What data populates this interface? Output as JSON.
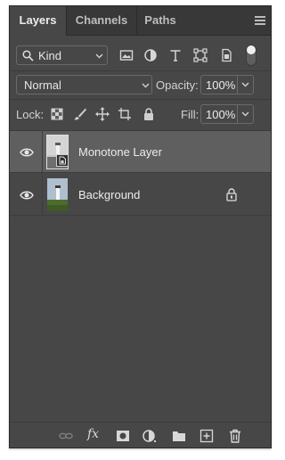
{
  "tabs": [
    {
      "label": "Layers",
      "active": true
    },
    {
      "label": "Channels",
      "active": false
    },
    {
      "label": "Paths",
      "active": false
    }
  ],
  "filter": {
    "kind_label": "Kind",
    "icons": [
      "image-filter-icon",
      "adjustment-filter-icon",
      "type-filter-icon",
      "shape-filter-icon",
      "smart-object-filter-icon"
    ],
    "toggle_on": true
  },
  "blend": {
    "mode": "Normal",
    "opacity_label": "Opacity:",
    "opacity_value": "100%"
  },
  "lock": {
    "label": "Lock:",
    "fill_label": "Fill:",
    "fill_value": "100%"
  },
  "layers": [
    {
      "name": "Monotone Layer",
      "visible": true,
      "selected": true,
      "smart_object": true,
      "locked": false
    },
    {
      "name": "Background",
      "visible": true,
      "selected": false,
      "smart_object": false,
      "locked": true
    }
  ],
  "toolbar": {
    "fx_label": "fx",
    "icons": [
      "link-layers-icon",
      "layer-style-icon",
      "add-mask-icon",
      "new-adjustment-icon",
      "new-group-icon",
      "new-layer-icon",
      "delete-layer-icon"
    ]
  },
  "colors": {
    "panel_bg": "#474747",
    "tab_bar_bg": "#383838",
    "selected_row": "#5f5f5f",
    "text": "#ececec"
  }
}
